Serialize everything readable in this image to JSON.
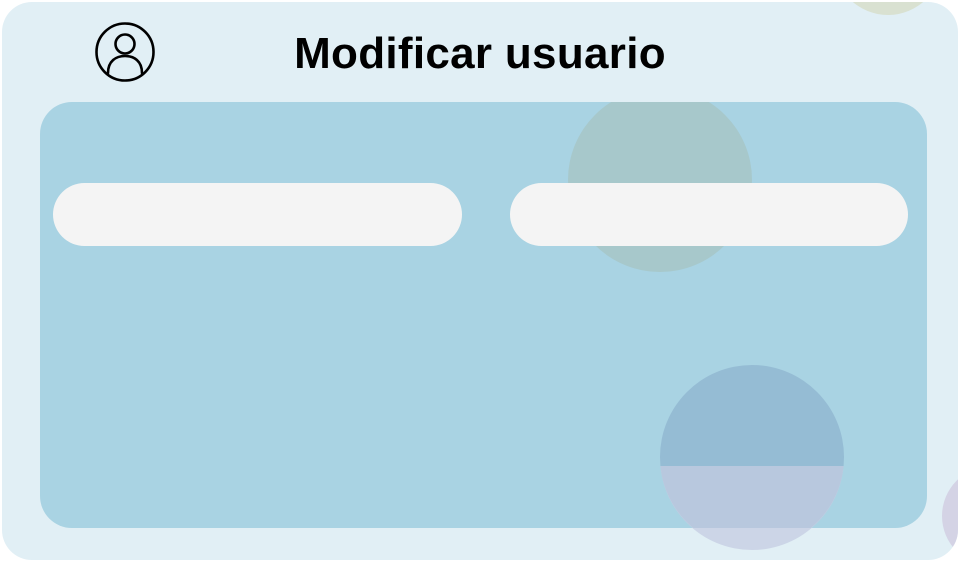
{
  "header": {
    "title": "Modificar usuario",
    "icon": "user-circle-icon"
  },
  "form": {
    "field_left": {
      "value": "",
      "placeholder": ""
    },
    "field_right": {
      "value": "",
      "placeholder": ""
    }
  },
  "colors": {
    "background": "#e1eff5",
    "panel": "#a9d3e3",
    "field": "#f4f4f4",
    "text": "#000000"
  }
}
